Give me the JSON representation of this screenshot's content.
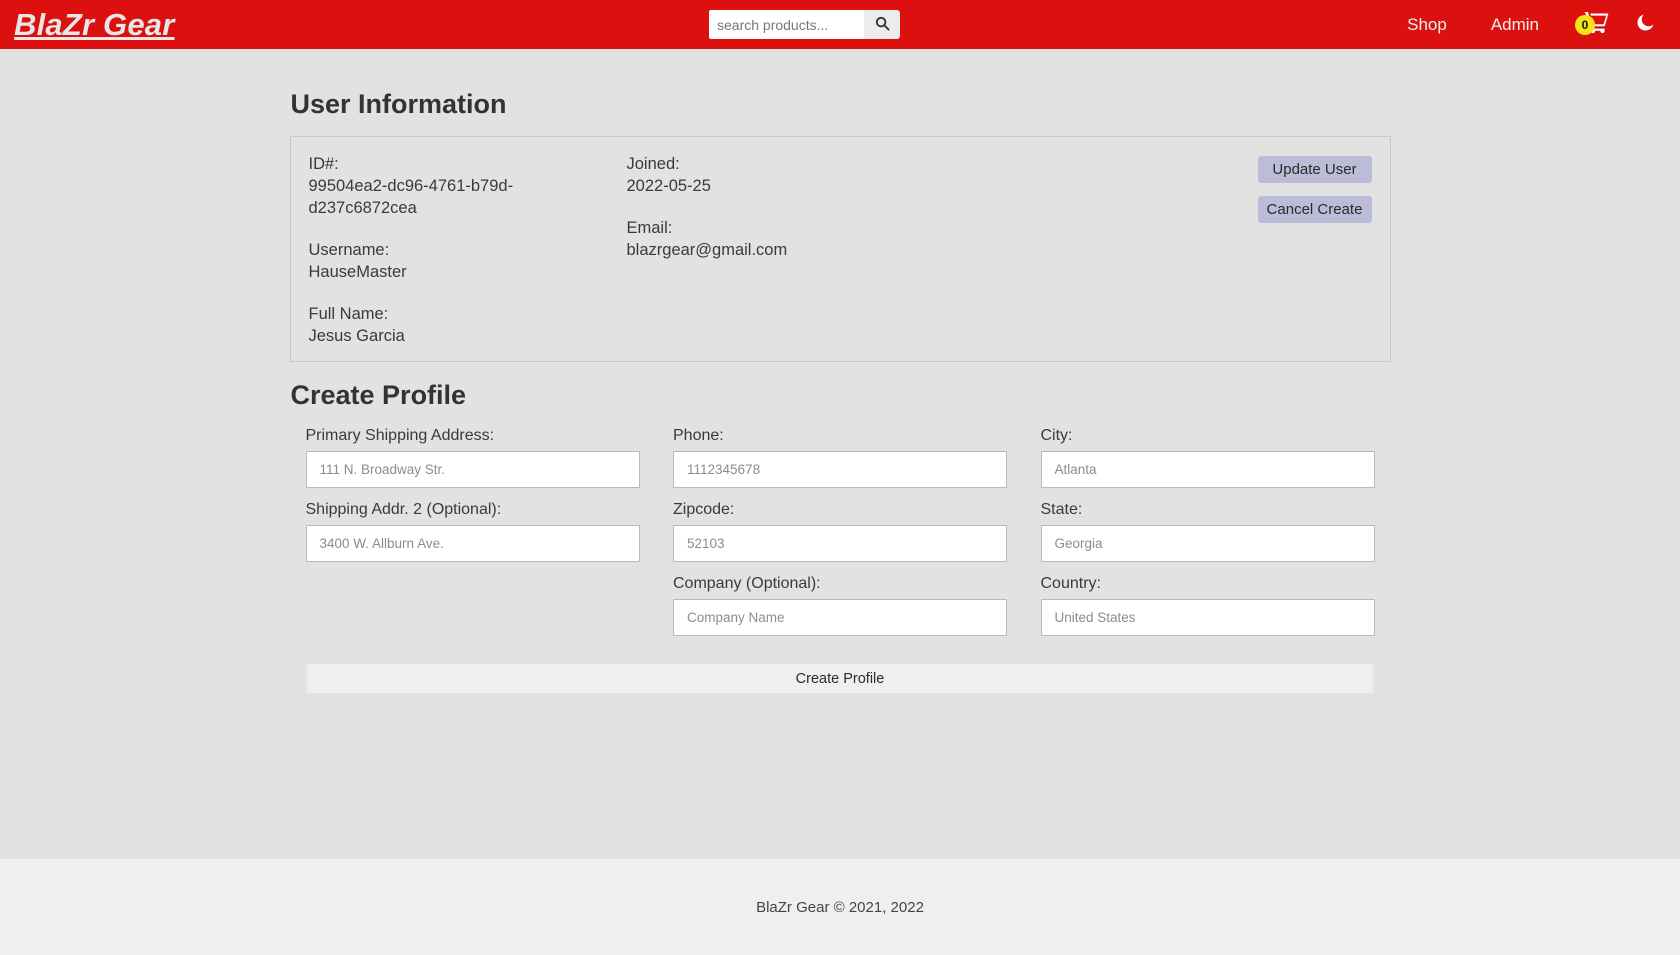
{
  "navbar": {
    "brand": "BlaZr Gear",
    "search": {
      "placeholder": "search products...",
      "value": "",
      "button_icon": "search-icon"
    },
    "links": [
      {
        "label": "Shop"
      },
      {
        "label": "Admin"
      }
    ],
    "cart": {
      "icon": "shopping-cart-icon",
      "count": "0"
    },
    "theme_toggle": {
      "icon": "moon-icon"
    },
    "colors": {
      "background": "#dd1010",
      "badge": "#f5e414",
      "link": "#f0f0f0"
    }
  },
  "user_information": {
    "title": "User Information",
    "fields": {
      "id_label": "ID#:",
      "id_value": "99504ea2-dc96-4761-b79d-d237c6872cea",
      "username_label": "Username:",
      "username_value": "HauseMaster",
      "fullname_label": "Full Name:",
      "fullname_value": "Jesus Garcia",
      "joined_label": "Joined:",
      "joined_value": "2022-05-25",
      "email_label": "Email:",
      "email_value": "blazrgear@gmail.com"
    },
    "actions": {
      "update": "Update User",
      "cancel": "Cancel Create",
      "color": "#bcbcd8"
    }
  },
  "create_profile": {
    "title": "Create Profile",
    "fields": [
      {
        "label": "Primary Shipping Address:",
        "placeholder": "111 N. Broadway Str.",
        "value": ""
      },
      {
        "label": "Phone:",
        "placeholder": "1112345678",
        "value": ""
      },
      {
        "label": "City:",
        "placeholder": "Atlanta",
        "value": ""
      },
      {
        "label": "Shipping Addr. 2 (Optional):",
        "placeholder": "3400 W. Allburn Ave.",
        "value": ""
      },
      {
        "label": "Zipcode:",
        "placeholder": "52103",
        "value": ""
      },
      {
        "label": "State:",
        "placeholder": "Georgia",
        "value": ""
      },
      {
        "label": "Company (Optional):",
        "placeholder": "Company Name",
        "value": ""
      },
      {
        "label": "Country:",
        "placeholder": "United States",
        "value": ""
      }
    ],
    "submit_label": "Create Profile"
  },
  "footer": {
    "text": "BlaZr Gear © 2021, 2022"
  }
}
